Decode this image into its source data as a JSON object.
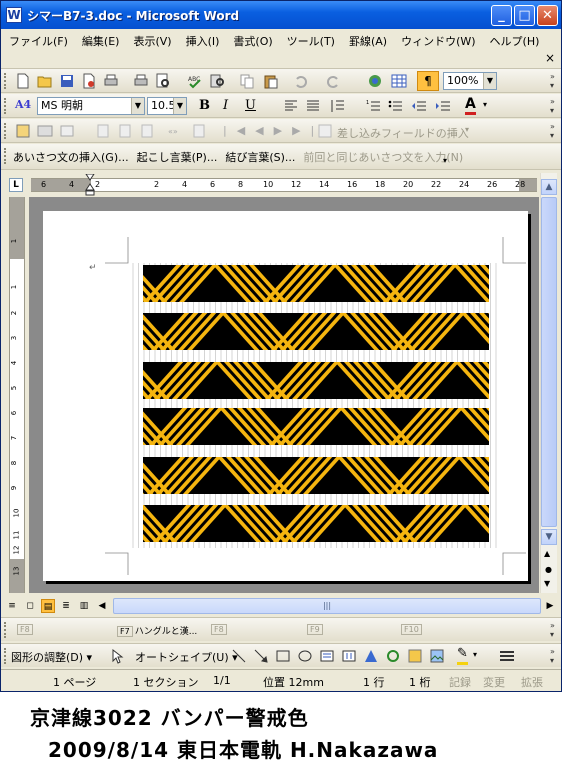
{
  "window": {
    "title": "シマーB7-3.doc - Microsoft Word",
    "app_icon": "W",
    "min_glyph": "_",
    "max_glyph": "□",
    "close_glyph": "✕"
  },
  "menu": {
    "items": [
      "ファイル(F)",
      "編集(E)",
      "表示(V)",
      "挿入(I)",
      "書式(O)",
      "ツール(T)",
      "罫線(A)",
      "ウィンドウ(W)",
      "ヘルプ(H)"
    ],
    "doc_close": "×"
  },
  "standard_toolbar": {
    "zoom": "100%"
  },
  "formatting_toolbar": {
    "font_name": "MS 明朝",
    "font_size": "10.5",
    "bold": "B",
    "italic": "I",
    "underline": "U",
    "font_color_letter": "A",
    "style_letter": "A4"
  },
  "mailmerge_toolbar": {
    "insert_merge_field": "差し込みフィールドの挿入"
  },
  "autotext_toolbar": {
    "items": [
      {
        "label": "あいさつ文の挿入(G)...",
        "enabled": true
      },
      {
        "label": "起こし言葉(P)...",
        "enabled": true
      },
      {
        "label": "結び言葉(S)...",
        "enabled": true
      },
      {
        "label": "前回と同じあいさつ文を入力(N)",
        "enabled": false
      }
    ]
  },
  "ruler": {
    "tab_selector": "L",
    "h_numbers": [
      "6",
      "4",
      "2",
      "2",
      "4",
      "6",
      "8",
      "10",
      "12",
      "14",
      "16",
      "18",
      "20",
      "22",
      "24",
      "26",
      "28"
    ],
    "v_numbers": [
      "1",
      "1",
      "2",
      "3",
      "4",
      "5",
      "6",
      "7",
      "8",
      "9",
      "10",
      "11",
      "12",
      "13"
    ]
  },
  "document": {
    "paragraph_mark": "↵",
    "pattern_colors": {
      "stripe": "#f5b50f",
      "background": "#000000"
    }
  },
  "hscroll": {
    "thumb_grip": "|||"
  },
  "fkeys": [
    {
      "key": "F8",
      "label": "",
      "enabled": false
    },
    {
      "key": "F7",
      "label": "ハングルと漢...",
      "enabled": true
    },
    {
      "key": "F8",
      "label": "",
      "enabled": false
    },
    {
      "key": "F9",
      "label": "",
      "enabled": false
    },
    {
      "key": "F10",
      "label": "",
      "enabled": false
    }
  ],
  "drawing_toolbar": {
    "draw_menu": "図形の調整(D)",
    "autoshape_menu": "オートシェイプ(U)"
  },
  "status": {
    "page": "1 ページ",
    "section": "1 セクション",
    "page_of": "1/1",
    "position": "位置 12mm",
    "line": "1 行",
    "column": "1 桁",
    "rec": "記録",
    "trk": "変更",
    "ext": "拡張"
  },
  "caption": {
    "line1": "京津線3022 バンパー警戒色",
    "line2": "2009/8/14 東日本電軌 H.Nakazawa"
  }
}
